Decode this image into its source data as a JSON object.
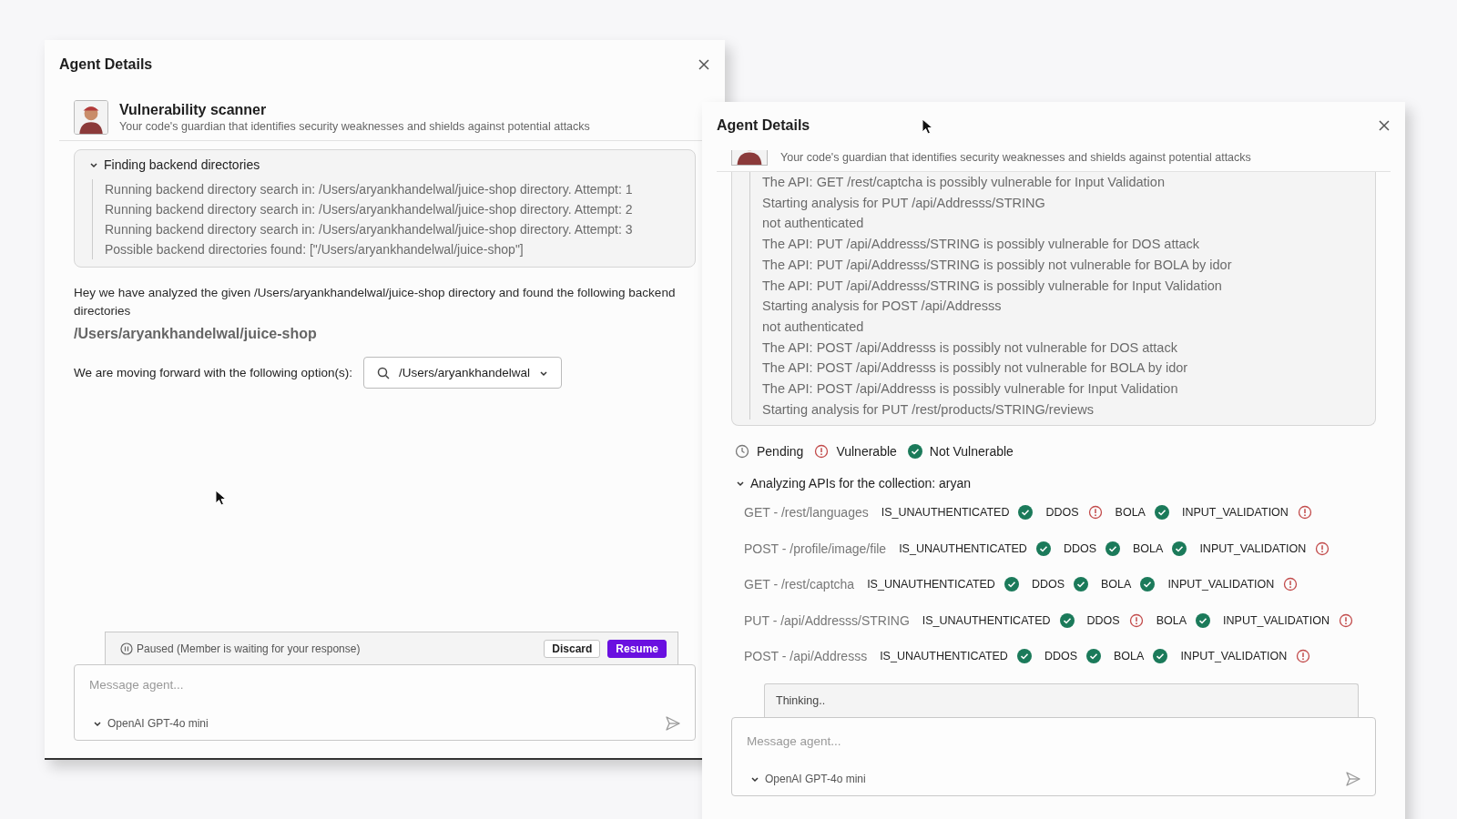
{
  "left_window": {
    "title": "Agent Details",
    "agent": {
      "name": "Vulnerability scanner",
      "description": "Your code's guardian that identifies security weaknesses and shields against potential attacks"
    },
    "log": {
      "title": "Finding backend directories",
      "expanded": true,
      "lines": [
        "Running backend directory search in: /Users/aryankhandelwal/juice-shop directory. Attempt: 1",
        "Running backend directory search in: /Users/aryankhandelwal/juice-shop directory. Attempt: 2",
        "Running backend directory search in: /Users/aryankhandelwal/juice-shop directory. Attempt: 3",
        "Possible backend directories found: [\"/Users/aryankhandelwal/juice-shop\"]"
      ]
    },
    "message": "Hey we have analyzed the given /Users/aryankhandelwal/juice-shop directory and found the following backend directories",
    "result_path": "/Users/aryankhandelwal/juice-shop",
    "option_label": "We are moving forward with the following option(s):",
    "option_value": "/Users/aryankhandelwal",
    "paused": {
      "text": "Paused (Member is waiting for your response)",
      "buttons": [
        {
          "label": "Discard",
          "kind": "secondary"
        },
        {
          "label": "Resume",
          "kind": "primary"
        }
      ]
    },
    "composer": {
      "placeholder": "Message agent...",
      "model": "OpenAI GPT-4o mini"
    }
  },
  "right_window": {
    "title": "Agent Details",
    "agent": {
      "description": "Your code's guardian that identifies security weaknesses and shields against potential attacks"
    },
    "log": {
      "lines": [
        "The API: GET /rest/captcha is possibly vulnerable for Input Validation",
        "Starting analysis for PUT /api/Addresss/STRING",
        "not authenticated",
        "The API: PUT /api/Addresss/STRING is possibly vulnerable for DOS attack",
        "The API: PUT /api/Addresss/STRING is possibly not vulnerable for BOLA by idor",
        "The API: PUT /api/Addresss/STRING is possibly vulnerable for Input Validation",
        "Starting analysis for POST /api/Addresss",
        "not authenticated",
        "The API: POST /api/Addresss is possibly not vulnerable for DOS attack",
        "The API: POST /api/Addresss is possibly not vulnerable for BOLA by idor",
        "The API: POST /api/Addresss is possibly vulnerable for Input Validation",
        "Starting analysis for PUT /rest/products/STRING/reviews"
      ]
    },
    "legend": [
      {
        "label": "Pending",
        "kind": "pending"
      },
      {
        "label": "Vulnerable",
        "kind": "vulnerable"
      },
      {
        "label": "Not Vulnerable",
        "kind": "safe"
      }
    ],
    "analysis": {
      "title": "Analyzing APIs for the collection: aryan",
      "expanded": true,
      "apis": [
        {
          "endpoint": "GET - /rest/languages",
          "checks": [
            {
              "name": "IS_UNAUTHENTICATED",
              "vulnerable": false
            },
            {
              "name": "DDOS",
              "vulnerable": true
            },
            {
              "name": "BOLA",
              "vulnerable": false
            },
            {
              "name": "INPUT_VALIDATION",
              "vulnerable": true
            }
          ]
        },
        {
          "endpoint": "POST - /profile/image/file",
          "checks": [
            {
              "name": "IS_UNAUTHENTICATED",
              "vulnerable": false
            },
            {
              "name": "DDOS",
              "vulnerable": false
            },
            {
              "name": "BOLA",
              "vulnerable": false
            },
            {
              "name": "INPUT_VALIDATION",
              "vulnerable": true
            }
          ]
        },
        {
          "endpoint": "GET - /rest/captcha",
          "checks": [
            {
              "name": "IS_UNAUTHENTICATED",
              "vulnerable": false
            },
            {
              "name": "DDOS",
              "vulnerable": false
            },
            {
              "name": "BOLA",
              "vulnerable": false
            },
            {
              "name": "INPUT_VALIDATION",
              "vulnerable": true
            }
          ]
        },
        {
          "endpoint": "PUT - /api/Addresss/STRING",
          "checks": [
            {
              "name": "IS_UNAUTHENTICATED",
              "vulnerable": false
            },
            {
              "name": "DDOS",
              "vulnerable": true
            },
            {
              "name": "BOLA",
              "vulnerable": false
            },
            {
              "name": "INPUT_VALIDATION",
              "vulnerable": true
            }
          ]
        },
        {
          "endpoint": "POST - /api/Addresss",
          "checks": [
            {
              "name": "IS_UNAUTHENTICATED",
              "vulnerable": false
            },
            {
              "name": "DDOS",
              "vulnerable": false
            },
            {
              "name": "BOLA",
              "vulnerable": false
            },
            {
              "name": "INPUT_VALIDATION",
              "vulnerable": true
            }
          ]
        }
      ]
    },
    "thinking": "Thinking..",
    "composer": {
      "placeholder": "Message agent...",
      "model": "OpenAI GPT-4o mini"
    }
  }
}
